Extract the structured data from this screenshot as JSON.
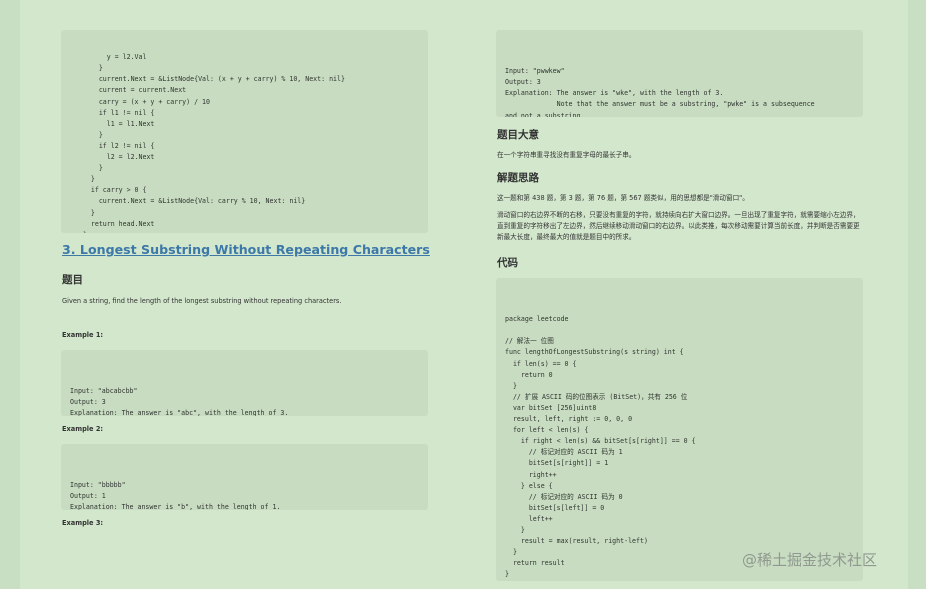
{
  "left": {
    "code_top": [
      "        y = l2.Val",
      "      }",
      "      current.Next = &ListNode{Val: (x + y + carry) % 10, Next: nil}",
      "      current = current.Next",
      "      carry = (x + y + carry) / 10",
      "      if l1 != nil {",
      "        l1 = l1.Next",
      "      }",
      "      if l2 != nil {",
      "        l2 = l2.Next",
      "      }",
      "    }",
      "    if carry > 0 {",
      "      current.Next = &ListNode{Val: carry % 10, Next: nil}",
      "    }",
      "    return head.Next",
      "  }"
    ],
    "section_title": "3. Longest Substring Without Repeating Characters",
    "heading_title": "题目",
    "description": "Given a string, find the length of the longest substring without repeating characters.",
    "example1_label": "Example 1:",
    "example1_code": [
      "Input: \"abcabcbb\"",
      "Output: 3",
      "Explanation: The answer is \"abc\", with the length of 3."
    ],
    "example2_label": "Example 2:",
    "example2_code": [
      "Input: \"bbbbb\"",
      "Output: 1",
      "Explanation: The answer is \"b\", with the length of 1."
    ],
    "example3_label": "Example 3:"
  },
  "right": {
    "example3_code": [
      "Input: \"pwwkew\"",
      "Output: 3",
      "Explanation: The answer is \"wke\", with the length of 3.",
      "             Note that the answer must be a substring, \"pwke\" is a subsequence",
      "and not a substring."
    ],
    "heading_meaning": "题目大意",
    "meaning_text": "在一个字符串重寻找没有重复字母的最长子串。",
    "heading_idea": "解题思路",
    "idea_text1": "这一题和第 438 题，第 3 题，第 76 题，第 567 题类似，用的思想都是\"滑动窗口\"。",
    "idea_text2": "滑动窗口的右边界不断的右移，只要没有重复的字符，就持续向右扩大窗口边界。一旦出现了重复字符，就需要缩小左边界，直到重复的字符移出了左边界，然后继续移动滑动窗口的右边界。以此类推，每次移动需要计算当前长度，并判断是否需要更新最大长度，最终最大的值就是题目中的所求。",
    "heading_code": "代码",
    "solution_code": [
      "package leetcode",
      "",
      "// 解法一 位图",
      "func lengthOfLongestSubstring(s string) int {",
      "  if len(s) == 0 {",
      "    return 0",
      "  }",
      "  // 扩展 ASCII 码的位图表示 (BitSet)，共有 256 位",
      "  var bitSet [256]uint8",
      "  result, left, right := 0, 0, 0",
      "  for left < len(s) {",
      "    if right < len(s) && bitSet[s[right]] == 0 {",
      "      // 标记对应的 ASCII 码为 1",
      "      bitSet[s[right]] = 1",
      "      right++",
      "    } else {",
      "      // 标记对应的 ASCII 码为 0",
      "      bitSet[s[left]] = 0",
      "      left++",
      "    }",
      "    result = max(result, right-left)",
      "  }",
      "  return result",
      "}"
    ]
  },
  "watermark": "@稀土掘金技术社区",
  "colors": {
    "background": "#c9dfc3",
    "page": "#d3e7cd",
    "code_block": "#c8dcc1",
    "link": "#3c78a8"
  }
}
